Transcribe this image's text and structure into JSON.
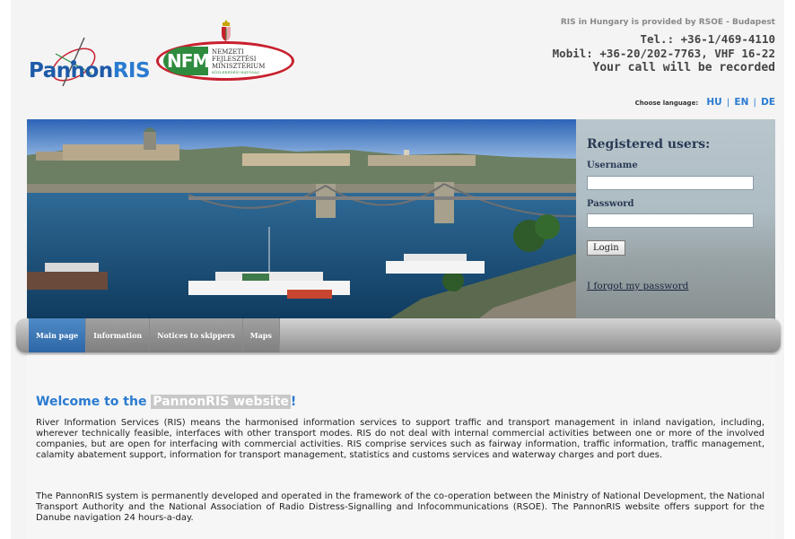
{
  "header": {
    "logo_pannon": {
      "prefix": "Pannon",
      "suffix": "RIS"
    },
    "logo_nfm": {
      "abbr": "NFM",
      "name_lines": [
        "NEMZETI",
        "FEJLESZTÉSI",
        "MINISZTÉRIUM"
      ],
      "tagline": "KÖZLEKEDÉSI HATÓSÁG"
    },
    "provided_by": "RIS in Hungary is provided by RSOE - Budapest",
    "tel": "Tel.: +36-1/469-4110",
    "mobil": "Mobil: +36-20/202-7763, VHF 16-22",
    "record_notice": "Your call will be recorded",
    "language": {
      "label": "Choose language:",
      "options": [
        "HU",
        "EN",
        "DE"
      ],
      "separator": "|"
    }
  },
  "login": {
    "title": "Registered users:",
    "username_label": "Username",
    "username_value": "",
    "password_label": "Password",
    "password_value": "",
    "button": "Login",
    "forgot": "I forgot my password"
  },
  "nav": {
    "items": [
      {
        "label": "Main page",
        "active": true
      },
      {
        "label": "Information",
        "active": false
      },
      {
        "label": "Notices to skippers",
        "active": false
      },
      {
        "label": "Maps",
        "active": false
      }
    ]
  },
  "content": {
    "welcome_prefix": "Welcome to the ",
    "welcome_highlight": "PannonRIS website",
    "welcome_suffix": "!",
    "paragraph1": "River Information Services (RIS) means the harmonised information services to support traffic and transport management in inland navigation, including, wherever technically feasible, interfaces with other transport modes. RIS do not deal with internal commercial activities between one or more of the involved companies, but are open for interfacing with commercial activities. RIS comprise services such as fairway information, traffic information, traffic management, calamity abatement support, information for transport management, statistics and customs services and waterway charges and port dues.",
    "paragraph2": "The PannonRIS system is permanently developed and operated in the framework of the co-operation between the Ministry of National Development, the National Transport Authority and the National Association of Radio Distress-Signalling and Infocommunications (RSOE). The PannonRIS website offers support for the Danube navigation 24 hours-a-day."
  },
  "colors": {
    "accent": "#2a7bd0",
    "nav_active": "#2f66a6",
    "nfm_red": "#c8202e",
    "nfm_green": "#2e8b3e"
  }
}
